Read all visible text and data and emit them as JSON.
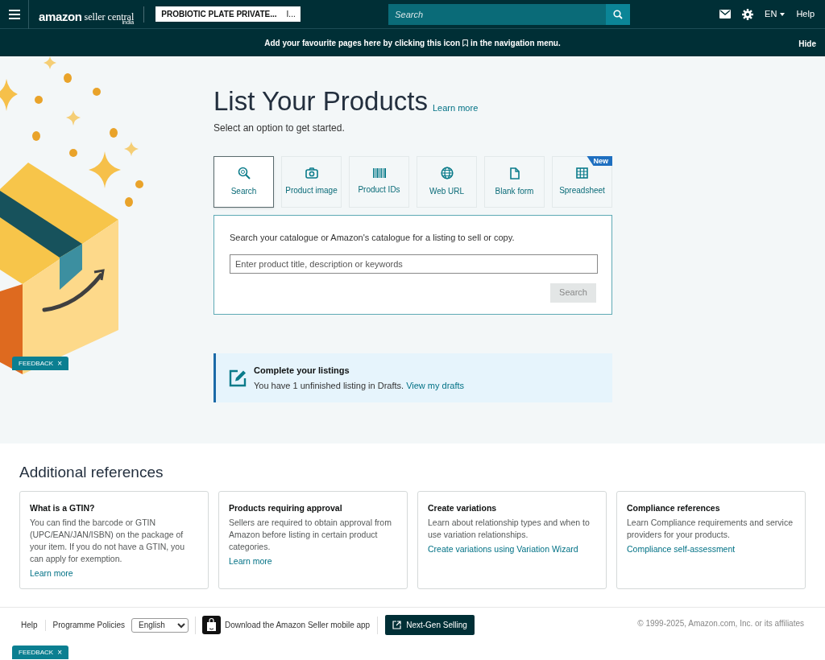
{
  "header": {
    "logo": {
      "brand": "amazon",
      "product": "seller central",
      "region": "india"
    },
    "account": {
      "name": "PROBIOTIC PLATE PRIVATE...",
      "marketplace": "I..."
    },
    "search": {
      "placeholder": "Search"
    },
    "language": "EN",
    "help": "Help"
  },
  "banner": {
    "before": "Add your favourite pages here by clicking this icon",
    "after": "in the navigation menu.",
    "hide": "Hide"
  },
  "main": {
    "title": "List Your Products",
    "learn_more": "Learn more",
    "subtitle": "Select an option to get started.",
    "options": [
      {
        "label": "Search",
        "selected": true
      },
      {
        "label": "Product image",
        "selected": false
      },
      {
        "label": "Product IDs",
        "selected": false
      },
      {
        "label": "Web URL",
        "selected": false
      },
      {
        "label": "Blank form",
        "selected": false
      },
      {
        "label": "Spreadsheet",
        "selected": false,
        "badge": "New"
      }
    ],
    "panel": {
      "prompt": "Search your catalogue or Amazon's catalogue for a listing to sell or copy.",
      "placeholder": "Enter product title, description or keywords",
      "button": "Search"
    },
    "drafts": {
      "title": "Complete your listings",
      "text": "You have 1 unfinished listing in Drafts.",
      "link": "View my drafts"
    }
  },
  "references": {
    "title": "Additional references",
    "cards": [
      {
        "title": "What is a GTIN?",
        "text": "You can find the barcode or GTIN (UPC/EAN/JAN/ISBN) on the package of your item. If you do not have a GTIN, you can apply for exemption.",
        "link": "Learn more"
      },
      {
        "title": "Products requiring approval",
        "text": "Sellers are required to obtain approval from Amazon before listing in certain product categories.",
        "link": "Learn more"
      },
      {
        "title": "Create variations",
        "text": "Learn about relationship types and when to use variation relationships.",
        "link": "Create variations using Variation Wizard"
      },
      {
        "title": "Compliance references",
        "text": "Learn Compliance requirements and service providers for your products.",
        "link": "Compliance self-assessment"
      }
    ]
  },
  "footer": {
    "links": [
      "Help",
      "Programme Policies"
    ],
    "language": "English",
    "app": "Download the Amazon Seller mobile app",
    "next_gen": "Next-Gen Selling",
    "copyright": "© 1999-2025, Amazon.com, Inc. or its affiliates"
  },
  "feedback": [
    {
      "label": "FEEDBACK",
      "close": "×"
    },
    {
      "label": "FEEDBACK",
      "close": "×"
    }
  ]
}
